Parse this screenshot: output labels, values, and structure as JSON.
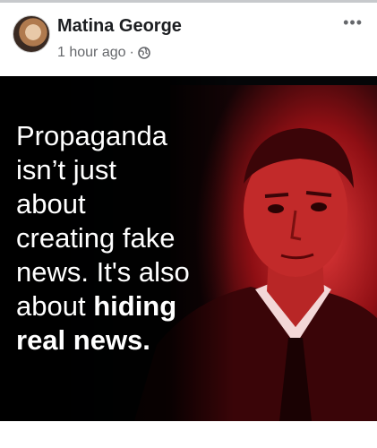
{
  "post": {
    "author_name": "Matina George",
    "timestamp": "1 hour ago",
    "separator": "·",
    "privacy_icon": "globe-icon",
    "more_label": "•••",
    "more_icon": "more-options-icon",
    "image": {
      "caption_lines": [
        "Propaganda",
        "isn’t just",
        "about",
        "creating fake",
        "news. It's also"
      ],
      "caption_line6_plain": "about ",
      "caption_line6_bold": "hiding",
      "caption_line7_bold": "real news.",
      "background_color": "#000000",
      "tint_color": "#c81414"
    }
  }
}
